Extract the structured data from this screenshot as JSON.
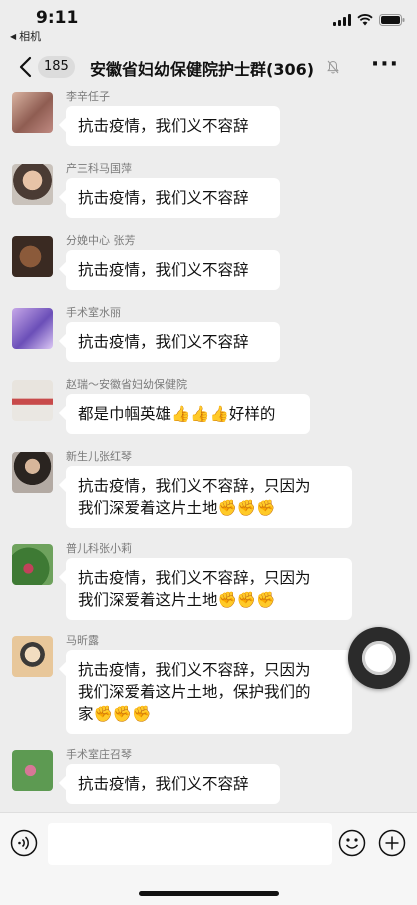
{
  "status_bar": {
    "time": "9:11",
    "back_app": "相机"
  },
  "nav": {
    "unread_count": "185",
    "title": "安徽省妇幼保健院护士群(306)"
  },
  "messages": [
    {
      "sender": "李辛任子",
      "text": "抗击疫情，我们义不容辞"
    },
    {
      "sender": "产三科马国萍",
      "text": "抗击疫情，我们义不容辞"
    },
    {
      "sender": "分娩中心 张芳",
      "text": "抗击疫情，我们义不容辞"
    },
    {
      "sender": "手术室水丽",
      "text": "抗击疫情，我们义不容辞"
    },
    {
      "sender": "赵瑞～安徽省妇幼保健院",
      "text": "都是巾帼英雄👍👍👍好样的"
    },
    {
      "sender": "新生儿张红琴",
      "text": "抗击疫情，我们义不容辞，只因为\n我们深爱着这片土地✊✊✊"
    },
    {
      "sender": "普儿科张小莉",
      "text": "抗击疫情，我们义不容辞，只因为\n我们深爱着这片土地✊✊✊"
    },
    {
      "sender": "马昕露",
      "text": "抗击疫情，我们义不容辞，只因为\n我们深爱着这片土地，保护我们的\n家✊✊✊"
    },
    {
      "sender": "手术室庄召琴",
      "text": "抗击疫情，我们义不容辞"
    }
  ],
  "icons": {
    "back": "chevron-left-icon",
    "mute": "bell-off-icon",
    "more": "more-dots-icon",
    "voice": "voice-icon",
    "emoji": "emoji-icon",
    "plus": "plus-circle-icon"
  }
}
